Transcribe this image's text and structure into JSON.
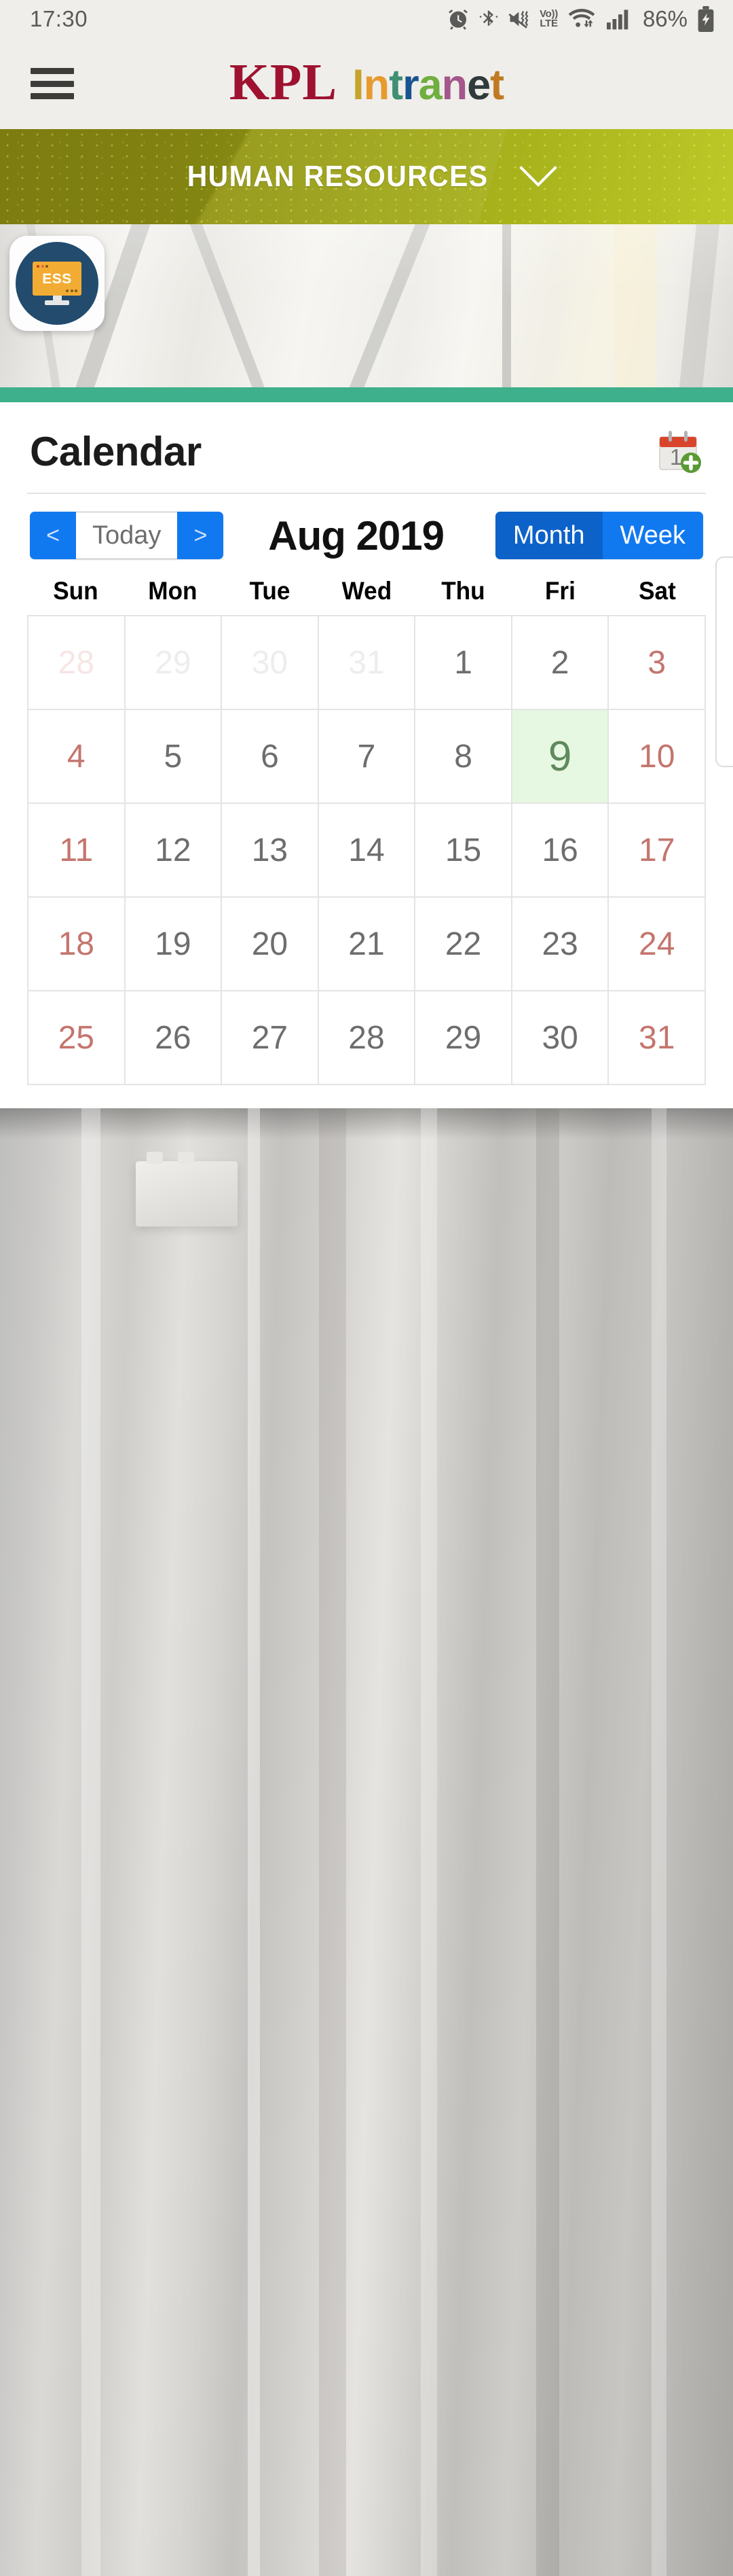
{
  "status_bar": {
    "time": "17:30",
    "battery_percent": "86%",
    "network_label_top": "Vo))",
    "network_label_bottom": "LTE",
    "icons": [
      "alarm-icon",
      "bluetooth-icon",
      "vibrate-icon",
      "volte-icon",
      "wifi-icon",
      "cellular-signal-icon",
      "battery-charging-icon"
    ]
  },
  "app_bar": {
    "menu_icon": "hamburger-menu-icon",
    "logo_primary": "KPL",
    "logo_secondary_letters": [
      {
        "char": "I",
        "color": "#c6a32b"
      },
      {
        "char": "n",
        "color": "#e79a2e"
      },
      {
        "char": "t",
        "color": "#3f8f72"
      },
      {
        "char": "r",
        "color": "#18548f"
      },
      {
        "char": "a",
        "color": "#6fae3f"
      },
      {
        "char": "n",
        "color": "#a3578a"
      },
      {
        "char": "e",
        "color": "#2f3b3a"
      },
      {
        "char": "t",
        "color": "#c07a22"
      }
    ]
  },
  "section_banner": {
    "title": "HUMAN RESOURCES",
    "chevron": "chevron-down-icon",
    "gradient_start": "#8a8a13",
    "gradient_end": "#bcc927"
  },
  "hero": {
    "tile_label": "ESS",
    "tile_icon": "ess-monitor-icon",
    "accent_rule_color": "#3fb08c"
  },
  "calendar": {
    "title": "Calendar",
    "add_icon": "add-calendar-event-icon",
    "add_icon_day": "1",
    "nav": {
      "prev_label": "<",
      "today_label": "Today",
      "next_label": ">"
    },
    "month_label": "Aug 2019",
    "views": [
      {
        "label": "Month",
        "active": true
      },
      {
        "label": "Week",
        "active": false
      }
    ],
    "weekdays": [
      "Sun",
      "Mon",
      "Tue",
      "Wed",
      "Thu",
      "Fri",
      "Sat"
    ],
    "today_color": "#e6f7e2",
    "weekend_color": "#c4756d",
    "weeks": [
      [
        {
          "day": "28",
          "other_month": true,
          "weekend": true,
          "today": false
        },
        {
          "day": "29",
          "other_month": true,
          "weekend": false,
          "today": false
        },
        {
          "day": "30",
          "other_month": true,
          "weekend": false,
          "today": false
        },
        {
          "day": "31",
          "other_month": true,
          "weekend": false,
          "today": false
        },
        {
          "day": "1",
          "other_month": false,
          "weekend": false,
          "today": false
        },
        {
          "day": "2",
          "other_month": false,
          "weekend": false,
          "today": false
        },
        {
          "day": "3",
          "other_month": false,
          "weekend": true,
          "today": false
        }
      ],
      [
        {
          "day": "4",
          "other_month": false,
          "weekend": true,
          "today": false
        },
        {
          "day": "5",
          "other_month": false,
          "weekend": false,
          "today": false
        },
        {
          "day": "6",
          "other_month": false,
          "weekend": false,
          "today": false
        },
        {
          "day": "7",
          "other_month": false,
          "weekend": false,
          "today": false
        },
        {
          "day": "8",
          "other_month": false,
          "weekend": false,
          "today": false
        },
        {
          "day": "9",
          "other_month": false,
          "weekend": false,
          "today": true
        },
        {
          "day": "10",
          "other_month": false,
          "weekend": true,
          "today": false
        }
      ],
      [
        {
          "day": "11",
          "other_month": false,
          "weekend": true,
          "today": false
        },
        {
          "day": "12",
          "other_month": false,
          "weekend": false,
          "today": false
        },
        {
          "day": "13",
          "other_month": false,
          "weekend": false,
          "today": false
        },
        {
          "day": "14",
          "other_month": false,
          "weekend": false,
          "today": false
        },
        {
          "day": "15",
          "other_month": false,
          "weekend": false,
          "today": false
        },
        {
          "day": "16",
          "other_month": false,
          "weekend": false,
          "today": false
        },
        {
          "day": "17",
          "other_month": false,
          "weekend": true,
          "today": false
        }
      ],
      [
        {
          "day": "18",
          "other_month": false,
          "weekend": true,
          "today": false
        },
        {
          "day": "19",
          "other_month": false,
          "weekend": false,
          "today": false
        },
        {
          "day": "20",
          "other_month": false,
          "weekend": false,
          "today": false
        },
        {
          "day": "21",
          "other_month": false,
          "weekend": false,
          "today": false
        },
        {
          "day": "22",
          "other_month": false,
          "weekend": false,
          "today": false
        },
        {
          "day": "23",
          "other_month": false,
          "weekend": false,
          "today": false
        },
        {
          "day": "24",
          "other_month": false,
          "weekend": true,
          "today": false
        }
      ],
      [
        {
          "day": "25",
          "other_month": false,
          "weekend": true,
          "today": false
        },
        {
          "day": "26",
          "other_month": false,
          "weekend": false,
          "today": false
        },
        {
          "day": "27",
          "other_month": false,
          "weekend": false,
          "today": false
        },
        {
          "day": "28",
          "other_month": false,
          "weekend": false,
          "today": false
        },
        {
          "day": "29",
          "other_month": false,
          "weekend": false,
          "today": false
        },
        {
          "day": "30",
          "other_month": false,
          "weekend": false,
          "today": false
        },
        {
          "day": "31",
          "other_month": false,
          "weekend": true,
          "today": false
        }
      ]
    ]
  }
}
